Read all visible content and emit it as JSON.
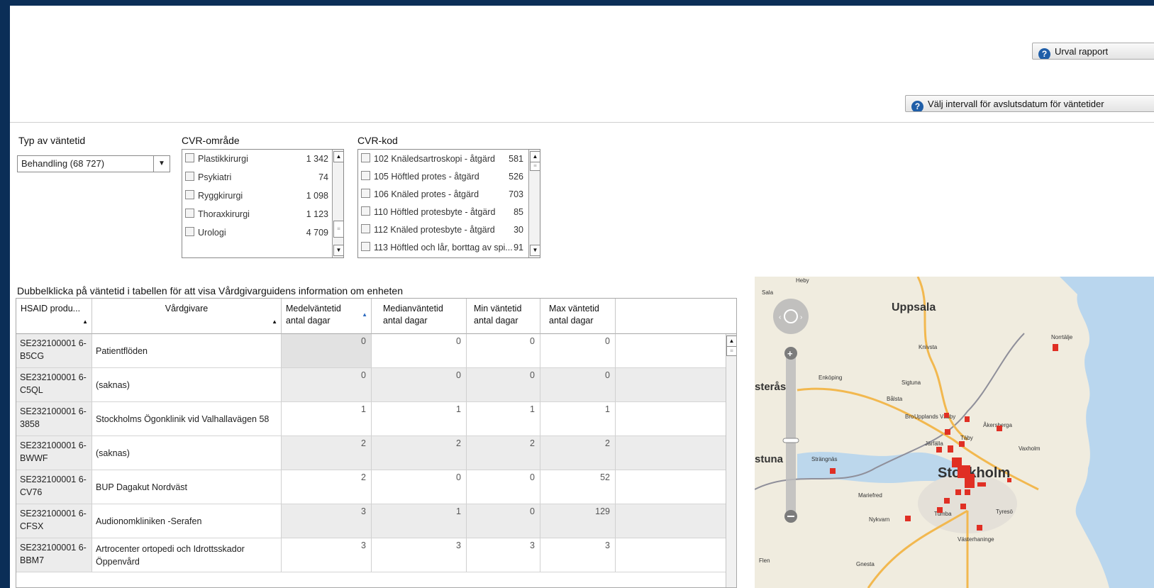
{
  "header": {
    "report_button_label": "Urval rapport",
    "interval_button_label": "Välj intervall för avslutsdatum för väntetider"
  },
  "filters": {
    "wait_type": {
      "label": "Typ av väntetid",
      "selected": "Behandling (68 727)"
    },
    "cvr_area": {
      "label": "CVR-område",
      "items": [
        {
          "name": "Plastikkirurgi",
          "count": "1 342"
        },
        {
          "name": "Psykiatri",
          "count": "74"
        },
        {
          "name": "Ryggkirurgi",
          "count": "1 098"
        },
        {
          "name": "Thoraxkirurgi",
          "count": "1 123"
        },
        {
          "name": "Urologi",
          "count": "4 709"
        }
      ]
    },
    "cvr_code": {
      "label": "CVR-kod",
      "items": [
        {
          "name": "102 Knäledsartroskopi - åtgärd",
          "count": "581"
        },
        {
          "name": "105 Höftled protes - åtgärd",
          "count": "526"
        },
        {
          "name": "106 Knäled protes - åtgärd",
          "count": "703"
        },
        {
          "name": "110 Höftled protesbyte - åtgärd",
          "count": "85"
        },
        {
          "name": "112 Knäled protesbyte - åtgärd",
          "count": "30"
        },
        {
          "name": "113 Höftled och lår, borttag av spi...",
          "count": "91"
        }
      ]
    }
  },
  "table": {
    "instruction": "Dubbelklicka på väntetid i tabellen för att visa Vårdgivarguidens information om enheten",
    "columns": {
      "hsaid": "HSAID produ...",
      "provider": "Vårdgivare",
      "mean": "Medelväntetid antal dagar",
      "median": "Medianväntetid antal dagar",
      "min": "Min väntetid antal dagar",
      "max": "Max väntetid antal dagar"
    },
    "rows": [
      {
        "id": "SE232100001 6-B5CG",
        "provider": "Patientflöden",
        "mean": "0",
        "median": "0",
        "min": "0",
        "max": "0"
      },
      {
        "id": "SE232100001 6-C5QL",
        "provider": "(saknas)",
        "mean": "0",
        "median": "0",
        "min": "0",
        "max": "0"
      },
      {
        "id": "SE232100001 6-3858",
        "provider": "Stockholms Ögonklinik vid Valhallavägen 58",
        "mean": "1",
        "median": "1",
        "min": "1",
        "max": "1"
      },
      {
        "id": "SE232100001 6-BWWF",
        "provider": "(saknas)",
        "mean": "2",
        "median": "2",
        "min": "2",
        "max": "2"
      },
      {
        "id": "SE232100001 6-CV76",
        "provider": "BUP Dagakut Nordväst",
        "mean": "2",
        "median": "0",
        "min": "0",
        "max": "52"
      },
      {
        "id": "SE232100001 6-CFSX",
        "provider": "Audionomkliniken -Serafen",
        "mean": "3",
        "median": "1",
        "min": "0",
        "max": "129"
      },
      {
        "id": "SE232100001 6-BBM7",
        "provider": "Artrocenter ortopedi och Idrottsskador Öppenvård",
        "mean": "3",
        "median": "3",
        "min": "3",
        "max": "3"
      }
    ]
  },
  "map": {
    "places": {
      "sala": "Sala",
      "heby": "Heby",
      "uppsala": "Uppsala",
      "norrtalje": "Norrtälje",
      "knivsta": "Knivsta",
      "enkoping": "Enköping",
      "sigtuna": "Sigtuna",
      "balsta": "Bålsta",
      "vasteras": "sterås",
      "bro": "Bro",
      "upplands_vasby": "Upplands Väsby",
      "akersberga": "Åkersberga",
      "taby": "Täby",
      "jarfalla": "Järfälla",
      "vaxholm": "Vaxholm",
      "eskilstuna": "stuna",
      "strangnas": "Strängnäs",
      "stockholm": "Stockholm",
      "mariefred": "Mariefred",
      "tyreso": "Tyresö",
      "tumba": "Tumba",
      "nykvarn": "Nykvarn",
      "vasterhaninge": "Västerhaninge",
      "flen": "Flen",
      "gnesta": "Gnesta"
    },
    "marker_color": "#e02f24"
  }
}
